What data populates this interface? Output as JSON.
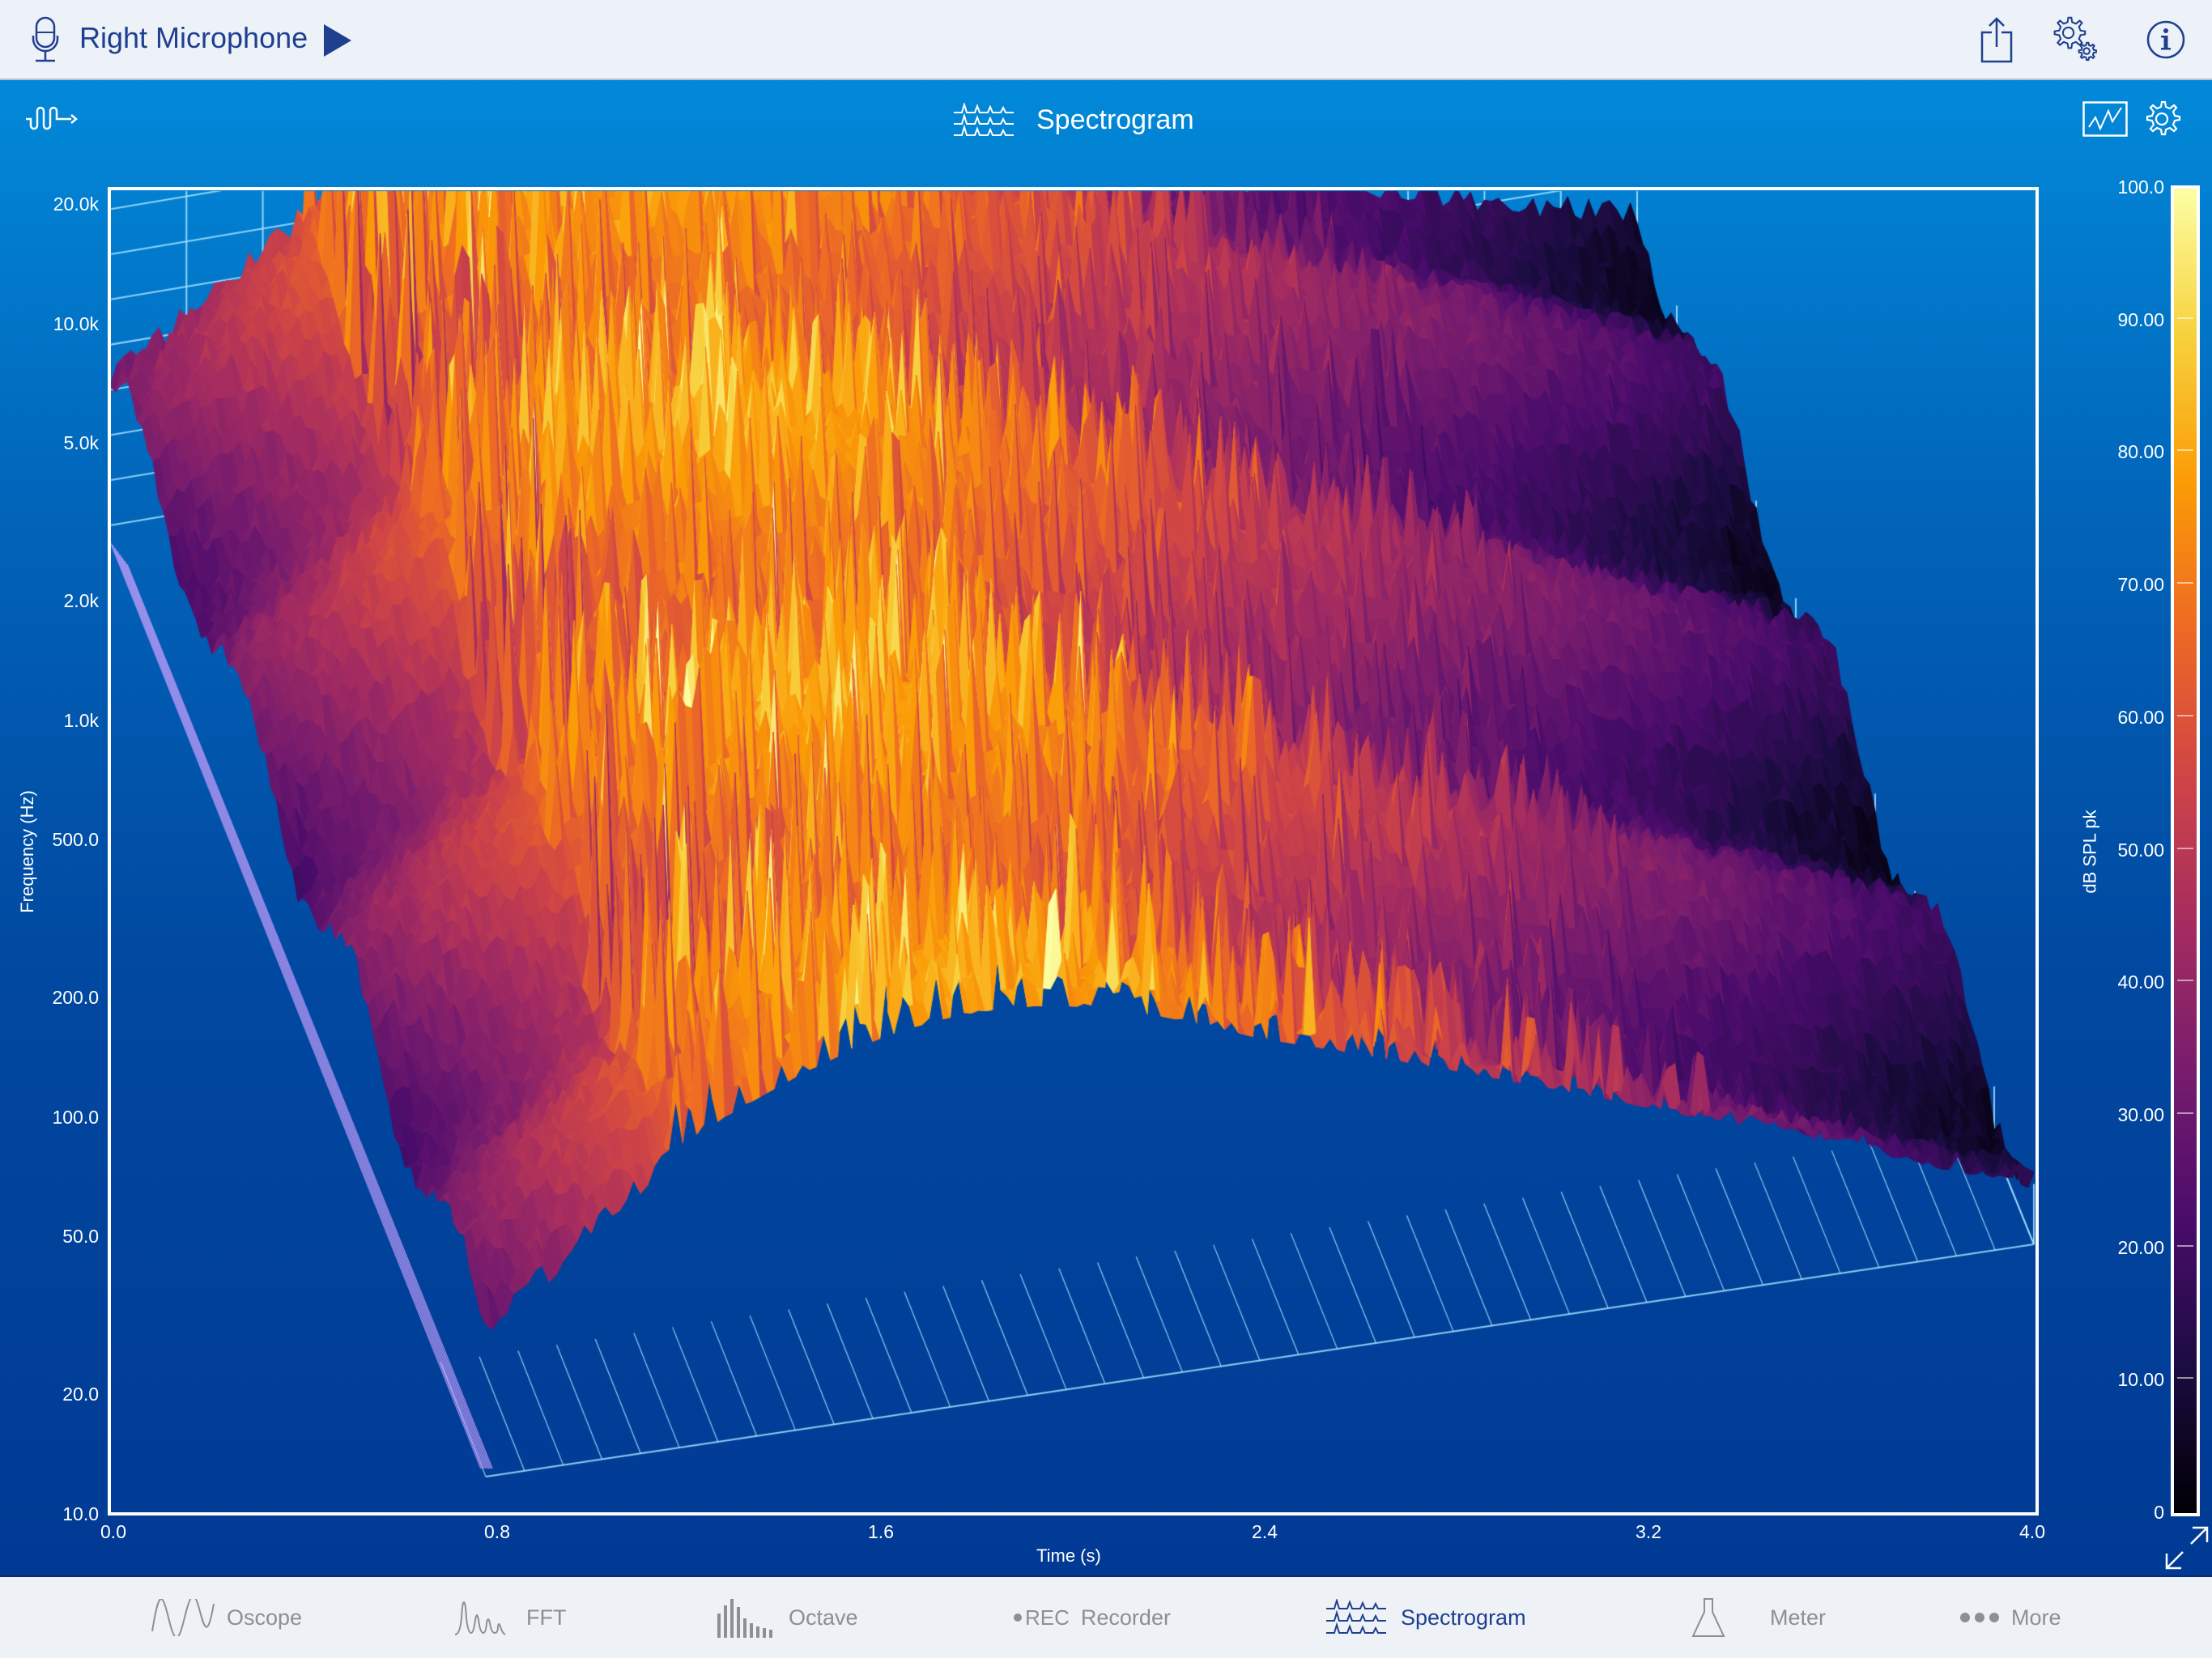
{
  "topbar": {
    "source_name": "Right Microphone",
    "icons": [
      "microphone-icon",
      "play-icon",
      "share-icon",
      "settings-gears-icon",
      "info-icon"
    ]
  },
  "header": {
    "title": "Spectrogram",
    "left_icon": "signal-generator-icon",
    "right_icons": [
      "chart-view-icon",
      "settings-gear-icon"
    ]
  },
  "colors": {
    "accent": "#1f3f8f",
    "tab_inactive": "#8e8e93",
    "panel_top": "#0289d9",
    "panel_bottom": "#013a94",
    "grid": "#a9e4ff"
  },
  "chart_data": {
    "type": "heatmap",
    "subtype": "3d-waterfall-spectrogram",
    "xlabel": "Time (s)",
    "ylabel": "Frequency (Hz)",
    "zlabel": "dB SPL pk",
    "xlim": [
      0.0,
      4.0
    ],
    "ylim": [
      10.0,
      20000.0
    ],
    "yscale": "log",
    "zlim": [
      0,
      100
    ],
    "x_ticks": [
      "0.0",
      "0.8",
      "1.6",
      "2.4",
      "3.2",
      "4.0"
    ],
    "y_ticks": [
      {
        "value": 20000,
        "label": "20.0k"
      },
      {
        "value": 10000,
        "label": "10.0k"
      },
      {
        "value": 5000,
        "label": "5.0k"
      },
      {
        "value": 2000,
        "label": "2.0k"
      },
      {
        "value": 1000,
        "label": "1.0k"
      },
      {
        "value": 500,
        "label": "500.0"
      },
      {
        "value": 200,
        "label": "200.0"
      },
      {
        "value": 100,
        "label": "100.0"
      },
      {
        "value": 50,
        "label": "50.0"
      },
      {
        "value": 20,
        "label": "20.0"
      },
      {
        "value": 10,
        "label": "10.0"
      }
    ],
    "colorbar_ticks": [
      {
        "value": 100,
        "label": "100.0"
      },
      {
        "value": 90,
        "label": "90.00"
      },
      {
        "value": 80,
        "label": "80.00"
      },
      {
        "value": 70,
        "label": "70.00"
      },
      {
        "value": 60,
        "label": "60.00"
      },
      {
        "value": 50,
        "label": "50.00"
      },
      {
        "value": 40,
        "label": "40.00"
      },
      {
        "value": 30,
        "label": "30.00"
      },
      {
        "value": 20,
        "label": "20.00"
      },
      {
        "value": 10,
        "label": "10.00"
      },
      {
        "value": 0,
        "label": "0"
      }
    ],
    "colormap": "inferno",
    "colormap_stops": [
      "#000004",
      "#1b0c41",
      "#4a0c6b",
      "#781c6d",
      "#a52c60",
      "#cf4446",
      "#ed6925",
      "#fb9b06",
      "#f7d13d",
      "#fcffa4"
    ],
    "description": "Energy mostly between 0.8 s and 2.6 s, peaking ~85-90 dB around 1.0-1.8 s across 50 Hz-20 kHz; decays to ~15-30 dB after 3.0 s.",
    "legend": "colorbar-right",
    "grid": true
  },
  "tabs": [
    {
      "label": "Oscope",
      "icon": "oscilloscope-icon",
      "active": false
    },
    {
      "label": "FFT",
      "icon": "fft-icon",
      "active": false
    },
    {
      "label": "Octave",
      "icon": "octave-bars-icon",
      "active": false
    },
    {
      "label": "Recorder",
      "icon": "rec-icon",
      "icon_text": "REC",
      "active": false
    },
    {
      "label": "Spectrogram",
      "icon": "spectrogram-icon",
      "active": true
    },
    {
      "label": "Meter",
      "icon": "flask-meter-icon",
      "active": false
    },
    {
      "label": "More",
      "icon": "more-dots-icon",
      "active": false
    }
  ]
}
